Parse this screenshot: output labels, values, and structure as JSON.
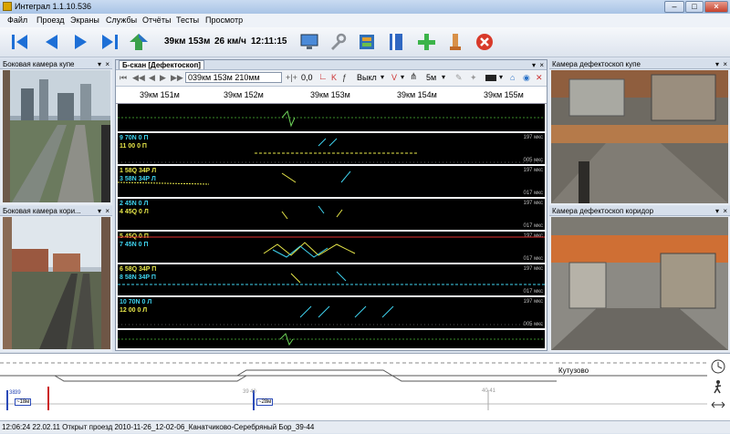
{
  "window": {
    "title": "Интеграл 1.1.10.536",
    "min": "–",
    "max": "□",
    "close": "×"
  },
  "menu": [
    "Файл",
    "Проезд",
    "Экраны",
    "Службы",
    "Отчёты",
    "Тесты",
    "Просмотр"
  ],
  "toolbar": {
    "position": "39км 153м",
    "speed": "26 км/ч",
    "time": "12:11:15"
  },
  "cameras": {
    "top_left": "Боковая камера купе",
    "bottom_left": "Боковая камера кори...",
    "top_right": "Камера дефектоскоп купе",
    "bottom_right": "Камера дефектоскоп коридор"
  },
  "bscan": {
    "tab": "Б-скан [Дефектоскоп]",
    "coord_value": "039км 153м 210мм",
    "gain": "0,0",
    "mode": "Выкл",
    "step": "5м",
    "k_label": "K",
    "ticks": [
      "39км 151м",
      "39км 152м",
      "39км 153м",
      "39км 154м",
      "39км 155м"
    ],
    "channels": [
      {
        "top": "9 70N 0 П",
        "bottom": "11 00 0 П",
        "right_top": "197 мкс",
        "right_bottom": "005 мкс"
      },
      {
        "top": "1 58Q 34P Л",
        "bottom": "3 58N 34P Л",
        "right_top": "197 мкс",
        "right_bottom": "017 мкс"
      },
      {
        "top": "2 45N 0 Л",
        "bottom": "4 45Q 0 Л",
        "right_top": "197 мкс",
        "right_bottom": "017 мкс"
      },
      {
        "top": "5 45Q 0 П",
        "bottom": "7 45N 0 П",
        "right_top": "197 мкс",
        "right_bottom": "017 мкс"
      },
      {
        "top": "6 58Q 34P П",
        "bottom": "8 58N 34P П",
        "right_top": "197 мкс",
        "right_bottom": "017 мкс"
      },
      {
        "top": "10 70N 0 Л",
        "bottom": "12 00 0 Л",
        "right_top": "197 мкс",
        "right_bottom": "005 мкс"
      }
    ]
  },
  "bottom": {
    "station": "Кутузово",
    "marker_left_km": "38",
    "marker_left_sub": "39",
    "marker_left_tag": "~18м",
    "marker_mid_km": "39",
    "marker_mid_sub": "40",
    "marker_mid_tag": "~28м",
    "marker_right": "40 41"
  },
  "status": "12:06:24 22.02.11 Открыт проезд 2010-11-26_12-02-06_Канатчиково-Серебряный Бор_39-44",
  "colors": {
    "yellow": "#e8e84a",
    "cyan": "#3fd4f0",
    "green": "#6fd45a",
    "red": "#e03030"
  }
}
